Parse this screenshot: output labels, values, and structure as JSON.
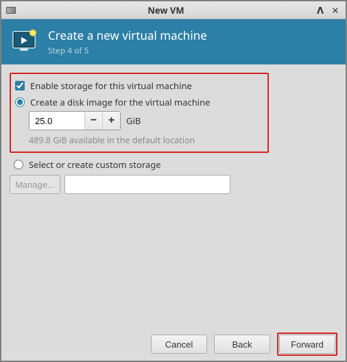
{
  "window": {
    "title": "New VM"
  },
  "header": {
    "title": "Create a new virtual machine",
    "subtitle": "Step 4 of 5"
  },
  "storage": {
    "enable_label": "Enable storage for this virtual machine",
    "enable_checked": true,
    "create_image_label": "Create a disk image for the virtual machine",
    "size_value": "25.0",
    "unit": "GiB",
    "available_hint": "489.8 GiB available in the default location",
    "custom_label": "Select or create custom storage",
    "manage_label": "Manage...",
    "path_value": ""
  },
  "buttons": {
    "cancel": "Cancel",
    "back": "Back",
    "forward": "Forward"
  },
  "glyphs": {
    "minus": "−",
    "plus": "+",
    "min": "ᐱ",
    "close": "✕"
  }
}
